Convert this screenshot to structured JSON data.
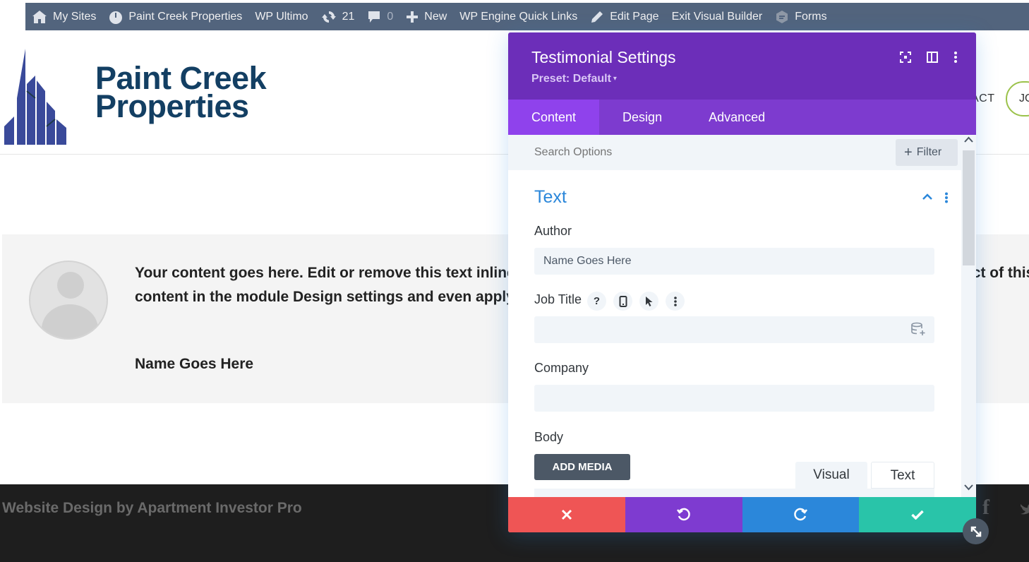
{
  "admin_bar": {
    "my_sites": "My Sites",
    "site_name": "Paint Creek Properties",
    "wp_ultimo": "WP Ultimo",
    "updates_count": "21",
    "comments_count": "0",
    "new_label": "New",
    "wp_engine": "WP Engine Quick Links",
    "edit_page": "Edit Page",
    "exit_builder": "Exit Visual Builder",
    "forms": "Forms"
  },
  "site": {
    "title_line1": "Paint Creek",
    "title_line2": "Properties",
    "nav_contact": "ACT",
    "nav_join": "JO"
  },
  "testimonial": {
    "body_line1": "Your content goes here. Edit or remove this text inline or in the module Content settings. You can also style every aspect of this",
    "body_line2": "content in the module Design settings and even apply custom CSS to this text in the module Advanced settings.",
    "author": "Name Goes Here"
  },
  "footer": {
    "credit": "Website Design by Apartment Investor Pro",
    "facebook_glyph": "f"
  },
  "modal": {
    "title": "Testimonial Settings",
    "preset": "Preset: Default",
    "preset_caret": "▾",
    "tabs": [
      "Content",
      "Design",
      "Advanced"
    ],
    "search_placeholder": "Search Options",
    "filter_label": "Filter",
    "section_title": "Text",
    "fields": {
      "author_label": "Author",
      "author_value": "Name Goes Here",
      "job_title_label": "Job Title",
      "job_title_value": "",
      "company_label": "Company",
      "company_value": "",
      "body_label": "Body"
    },
    "add_media": "ADD MEDIA",
    "editor_tabs": {
      "visual": "Visual",
      "text": "Text"
    }
  },
  "colors": {
    "admin_bar": "#52647d",
    "modal_header": "#6c2eb9",
    "tab_bar": "#7d3bcf",
    "tab_active": "#8f42ec",
    "section_title": "#2b87da",
    "cancel": "#ef5555",
    "undo": "#7e3bd0",
    "redo": "#2b87da",
    "save": "#29c4a9",
    "logo_blue": "#133f63"
  }
}
